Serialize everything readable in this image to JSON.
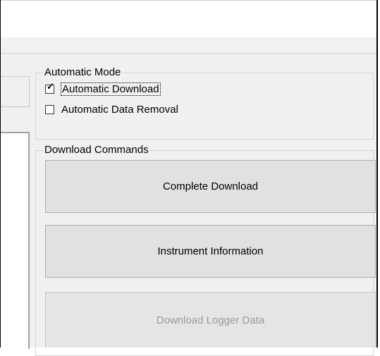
{
  "automatic_mode": {
    "title": "Automatic Mode",
    "options": [
      {
        "label": "Automatic Download",
        "checked": true,
        "focused": true
      },
      {
        "label": "Automatic Data Removal",
        "checked": false,
        "focused": false
      }
    ]
  },
  "download_commands": {
    "title": "Download Commands",
    "buttons": [
      {
        "label": "Complete Download",
        "enabled": true
      },
      {
        "label": "Instrument Information",
        "enabled": true
      },
      {
        "label": "Download Logger Data",
        "enabled": false
      }
    ]
  },
  "icons": {
    "checkmark": "check-mark-icon"
  }
}
